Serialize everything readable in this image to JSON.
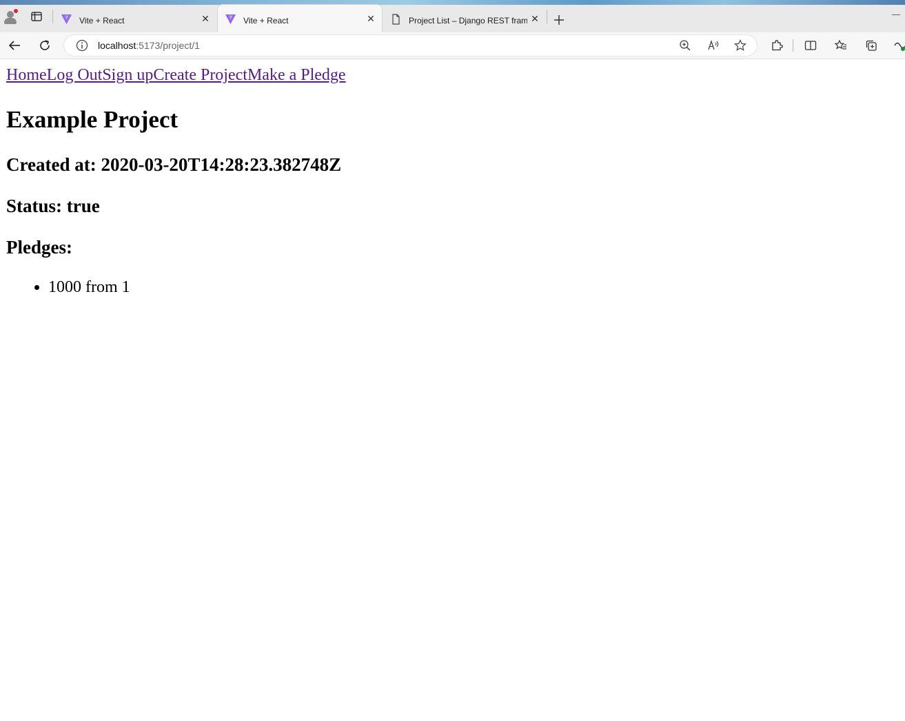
{
  "browser": {
    "tabs": [
      {
        "title": "Vite + React",
        "active": false
      },
      {
        "title": "Vite + React",
        "active": true
      },
      {
        "title": "Project List – Django REST framework",
        "active": false
      }
    ],
    "address": {
      "host": "localhost",
      "path": ":5173/project/1"
    }
  },
  "nav": {
    "links": [
      "Home",
      "Log Out",
      "Sign up",
      "Create Project",
      "Make a Pledge"
    ]
  },
  "project": {
    "title": "Example Project",
    "created_label": "Created at: 2020-03-20T14:28:23.382748Z",
    "status_label": "Status: true",
    "pledges_heading": "Pledges:",
    "pledges": [
      "1000 from 1"
    ]
  },
  "colors": {
    "link": "#551a8b",
    "vite_purple": "#a259ff",
    "vite_yellow": "#ffc517"
  },
  "icons": [
    "profile-icon",
    "tab-actions-icon",
    "vite-icon",
    "page-icon",
    "close-icon",
    "plus-icon",
    "back-icon",
    "refresh-icon",
    "info-icon",
    "zoom-icon",
    "read-aloud-icon",
    "favorite-icon",
    "extensions-icon",
    "split-screen-icon",
    "favorites-icon",
    "collections-icon",
    "copilot-icon"
  ]
}
